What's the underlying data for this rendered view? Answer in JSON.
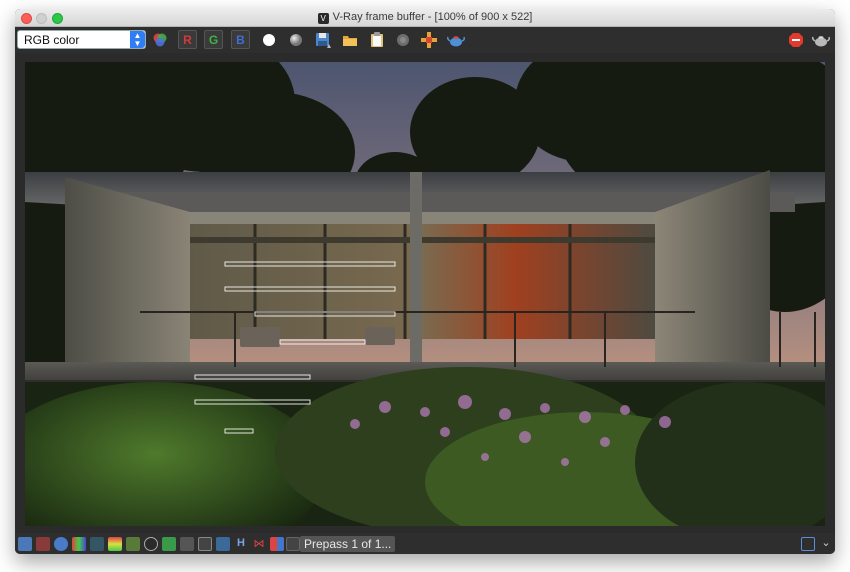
{
  "window": {
    "title": "V-Ray frame buffer - [100% of 900 x 522]"
  },
  "toolbar": {
    "channel_select": "RGB color",
    "red_label": "R",
    "green_label": "G",
    "blue_label": "B",
    "colors": {
      "red": "#d23a3a",
      "green": "#3fb24a",
      "blue": "#3d6fd6",
      "stop": "#e23a2d"
    }
  },
  "status": {
    "text": "Prepass 1 of 1..."
  }
}
